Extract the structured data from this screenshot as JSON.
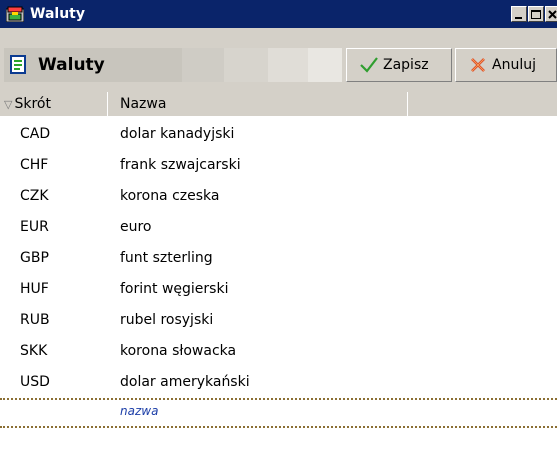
{
  "window": {
    "title": "Waluty"
  },
  "toolbar": {
    "title": "Waluty",
    "save_label": "Zapisz",
    "cancel_label": "Anuluj"
  },
  "icons": {
    "app": "currency-window-icon",
    "sheet": "sheet-icon",
    "save": "checkmark-icon",
    "cancel": "x-cross-icon",
    "sort": "sort-desc-icon"
  },
  "grid": {
    "columns": [
      "Skrót",
      "Nazwa"
    ],
    "rows": [
      {
        "code": "CAD",
        "name": "dolar kanadyjski"
      },
      {
        "code": "CHF",
        "name": "frank szwajcarski"
      },
      {
        "code": "CZK",
        "name": "korona czeska"
      },
      {
        "code": "EUR",
        "name": "euro"
      },
      {
        "code": "GBP",
        "name": "funt szterling"
      },
      {
        "code": "HUF",
        "name": "forint węgierski"
      },
      {
        "code": "RUB",
        "name": "rubel rosyjski"
      },
      {
        "code": "SKK",
        "name": "korona słowacka"
      },
      {
        "code": "USD",
        "name": "dolar amerykański"
      }
    ],
    "new_row_placeholder": "nazwa"
  },
  "colors": {
    "titlebar": "#0a246a",
    "face": "#d4d0c8",
    "placeholder": "#1d3fa8",
    "divider": "#8b6f34"
  }
}
